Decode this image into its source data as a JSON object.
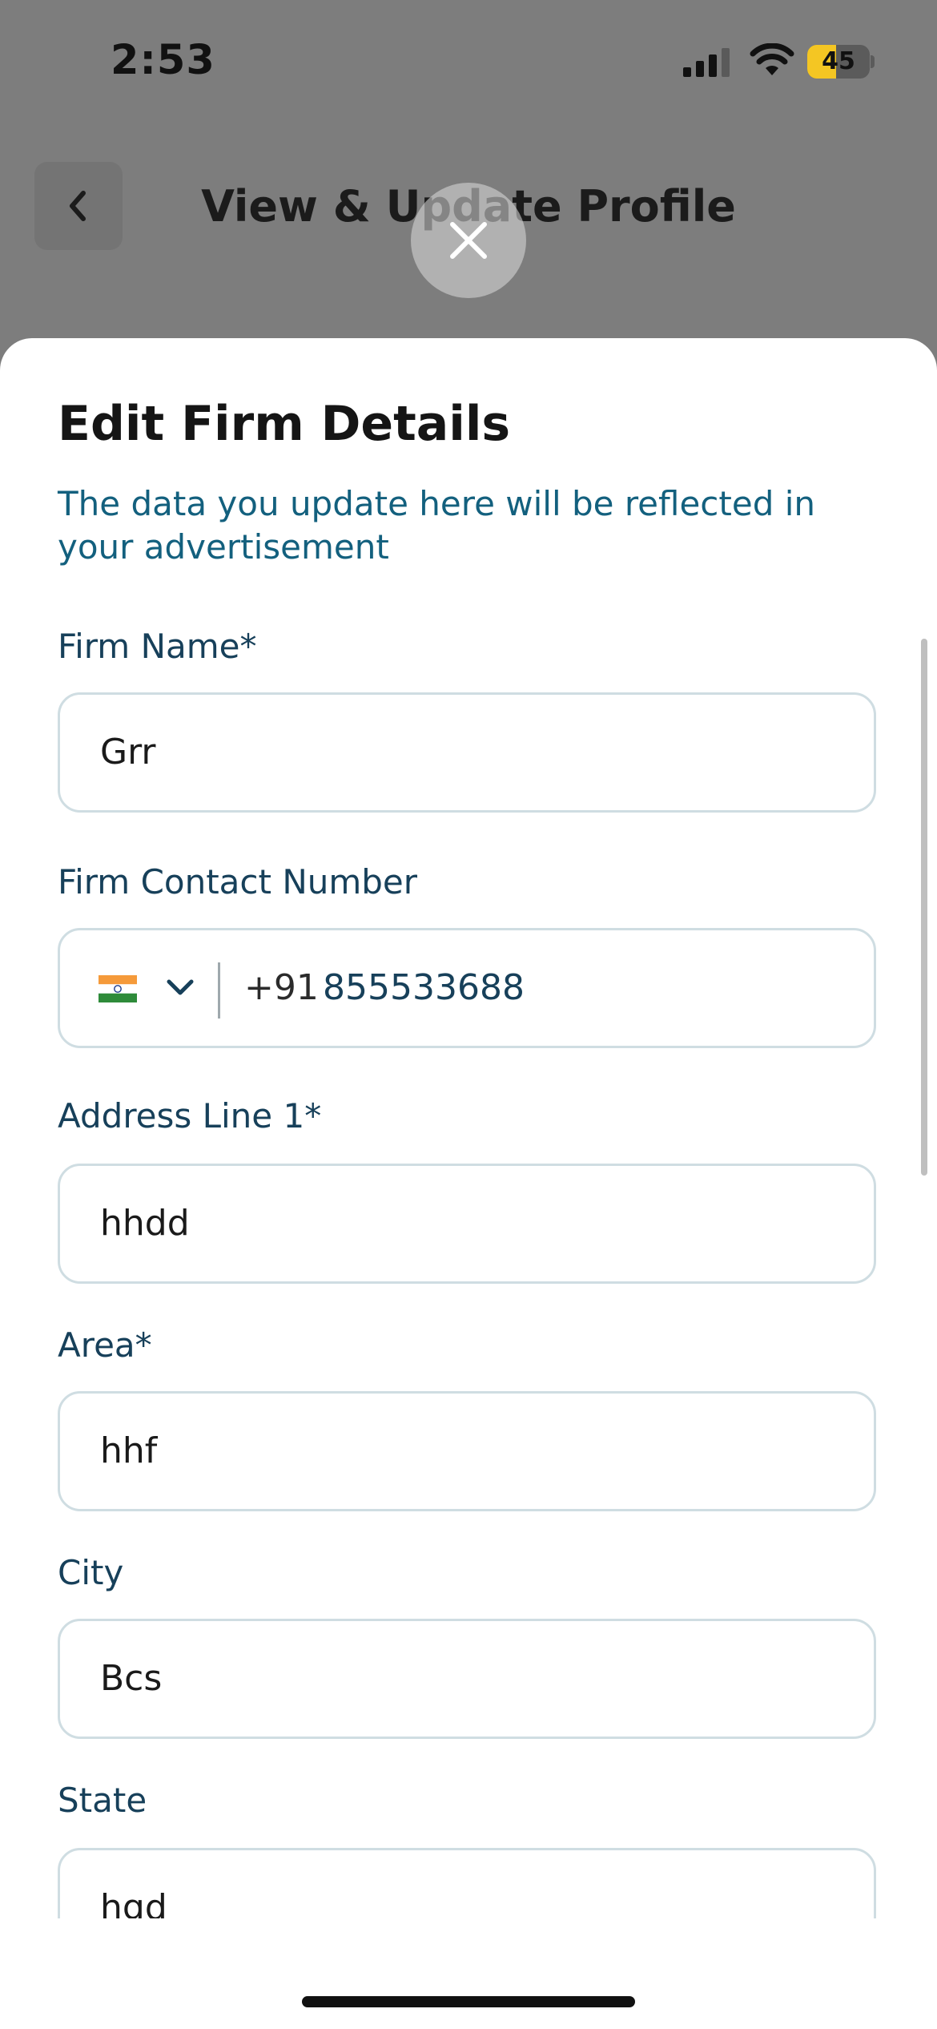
{
  "status_bar": {
    "time": "2:53",
    "battery": "45",
    "icons": [
      "signal-icon",
      "wifi-icon",
      "battery-icon"
    ]
  },
  "background_page": {
    "title": "View & Update Profile",
    "back_icon": "chevron-left-icon"
  },
  "overlay": {
    "close_icon": "close-icon"
  },
  "sheet": {
    "title": "Edit Firm Details",
    "subtitle": "The data you update here will be reflected in your advertisement",
    "fields": {
      "firm_name": {
        "label": "Firm Name*",
        "value": "Grr"
      },
      "firm_contact": {
        "label": "Firm Contact Number",
        "flag_icon": "india-flag-icon",
        "dropdown_icon": "chevron-down-icon",
        "country_code": "+91",
        "value": "855533688"
      },
      "address_line_1": {
        "label": "Address Line 1*",
        "value": "hhdd"
      },
      "area": {
        "label": "Area*",
        "value": "hhf"
      },
      "city": {
        "label": "City",
        "value": "Bcs"
      },
      "state": {
        "label": "State",
        "value": "hgd"
      }
    }
  },
  "colors": {
    "dim_overlay": "#7d7d7d",
    "subtitle": "#13607e",
    "label": "#17405a",
    "field_border": "#cfdde2",
    "battery_fill": "#f4c623"
  }
}
